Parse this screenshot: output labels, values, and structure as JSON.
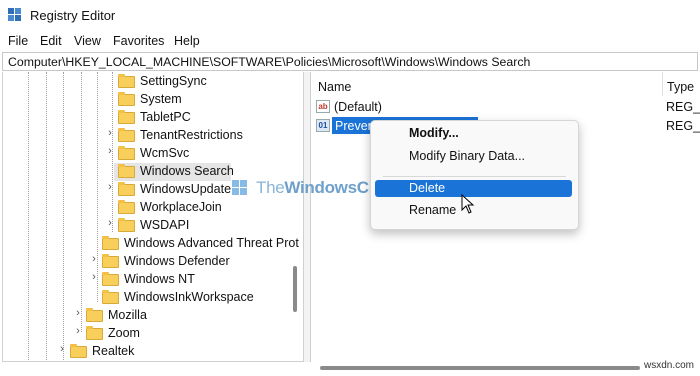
{
  "window": {
    "title": "Registry Editor",
    "icon": "regedit-cubes-icon"
  },
  "menu": {
    "items": [
      "File",
      "Edit",
      "View",
      "Favorites",
      "Help"
    ]
  },
  "address": {
    "path": "Computer\\HKEY_LOCAL_MACHINE\\SOFTWARE\\Policies\\Microsoft\\Windows\\Windows Search"
  },
  "tree": {
    "items": [
      {
        "label": "SettingSync",
        "expandable": false,
        "selected": false
      },
      {
        "label": "System",
        "expandable": false,
        "selected": false
      },
      {
        "label": "TabletPC",
        "expandable": false,
        "selected": false
      },
      {
        "label": "TenantRestrictions",
        "expandable": true,
        "selected": false
      },
      {
        "label": "WcmSvc",
        "expandable": true,
        "selected": false
      },
      {
        "label": "Windows Search",
        "expandable": false,
        "selected": true
      },
      {
        "label": "WindowsUpdate",
        "expandable": true,
        "selected": false
      },
      {
        "label": "WorkplaceJoin",
        "expandable": false,
        "selected": false
      },
      {
        "label": "WSDAPI",
        "expandable": true,
        "selected": false
      },
      {
        "label": "Windows Advanced Threat Prot",
        "expandable": false,
        "selected": false
      },
      {
        "label": "Windows Defender",
        "expandable": true,
        "selected": false
      },
      {
        "label": "Windows NT",
        "expandable": true,
        "selected": false
      },
      {
        "label": "WindowsInkWorkspace",
        "expandable": false,
        "selected": false
      },
      {
        "label": "Mozilla",
        "expandable": true,
        "selected": false
      },
      {
        "label": "Zoom",
        "expandable": true,
        "selected": false
      },
      {
        "label": "Realtek",
        "expandable": true,
        "selected": false
      }
    ]
  },
  "values": {
    "columns": {
      "name": "Name",
      "type": "Type"
    },
    "rows": [
      {
        "name": "(Default)",
        "type": "REG_SZ",
        "icon": "string-value-icon"
      },
      {
        "name": "Prevent",
        "type": "REG_D",
        "icon": "dword-value-icon",
        "selected": true
      }
    ]
  },
  "context_menu": {
    "items": [
      {
        "label": "Modify...",
        "bold": true
      },
      {
        "label": "Modify Binary Data..."
      },
      {
        "label": "Delete",
        "highlighted": true
      },
      {
        "label": "Rename"
      }
    ]
  },
  "watermark": {
    "text_prefix": "The",
    "text_main": "WindowsClub"
  },
  "site_mark": "wsxdn.com",
  "colors": {
    "selection": "#1a73d6",
    "folder": "#f7cf5a",
    "tree_selected": "#e5e5e5"
  }
}
